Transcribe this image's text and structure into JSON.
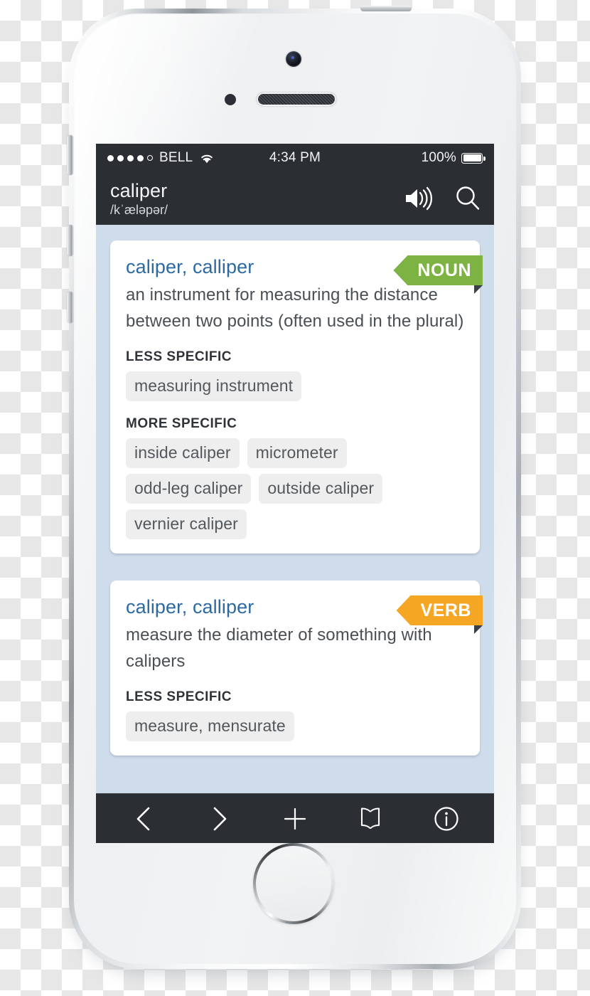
{
  "device": {
    "name": "iphone-5s-white",
    "hardware": {
      "camera": "front-camera",
      "sensor": "proximity-sensor",
      "speaker": "earpiece-speaker",
      "home_button": "home-button",
      "mute_switch": "mute-switch",
      "volume_up": "volume-up-button",
      "volume_down": "volume-down-button",
      "power": "power-button"
    }
  },
  "status_bar": {
    "signal_dots_filled": 4,
    "signal_dots_total": 5,
    "carrier": "BELL",
    "wifi_icon": "wifi-icon",
    "time": "4:34 PM",
    "battery_percent": "100%",
    "battery_level": 100
  },
  "navbar": {
    "headword": "caliper",
    "phonetic": "/kˈæləpər/",
    "speaker_icon": "speaker-icon",
    "search_icon": "search-icon"
  },
  "colors": {
    "noun_badge": "#7cb342",
    "verb_badge": "#f5a623",
    "headword": "#2d6aa3",
    "screen_background": "#cfdcec",
    "chrome": "#2b2f33"
  },
  "entries": [
    {
      "headword": "caliper, calliper",
      "pos": "NOUN",
      "pos_color": "#7cb342",
      "definition": "an instrument for measuring the distance between two points (often used in the plural)",
      "sections": [
        {
          "label": "LESS SPECIFIC",
          "chips": [
            "measuring instrument"
          ]
        },
        {
          "label": "MORE SPECIFIC",
          "chips": [
            "inside caliper",
            "micrometer",
            "odd-leg caliper",
            "outside caliper",
            "vernier caliper"
          ]
        }
      ]
    },
    {
      "headword": "caliper, calliper",
      "pos": "VERB",
      "pos_color": "#f5a623",
      "definition": "measure the diameter of something with calipers",
      "sections": [
        {
          "label": "LESS SPECIFIC",
          "chips": [
            "measure, mensurate"
          ]
        }
      ]
    }
  ],
  "toolbar": {
    "buttons": [
      {
        "name": "back-button",
        "icon": "chevron-left-icon"
      },
      {
        "name": "forward-button",
        "icon": "chevron-right-icon"
      },
      {
        "name": "add-button",
        "icon": "plus-icon"
      },
      {
        "name": "bookmarks-button",
        "icon": "book-icon"
      },
      {
        "name": "info-button",
        "icon": "info-circle-icon"
      }
    ]
  }
}
